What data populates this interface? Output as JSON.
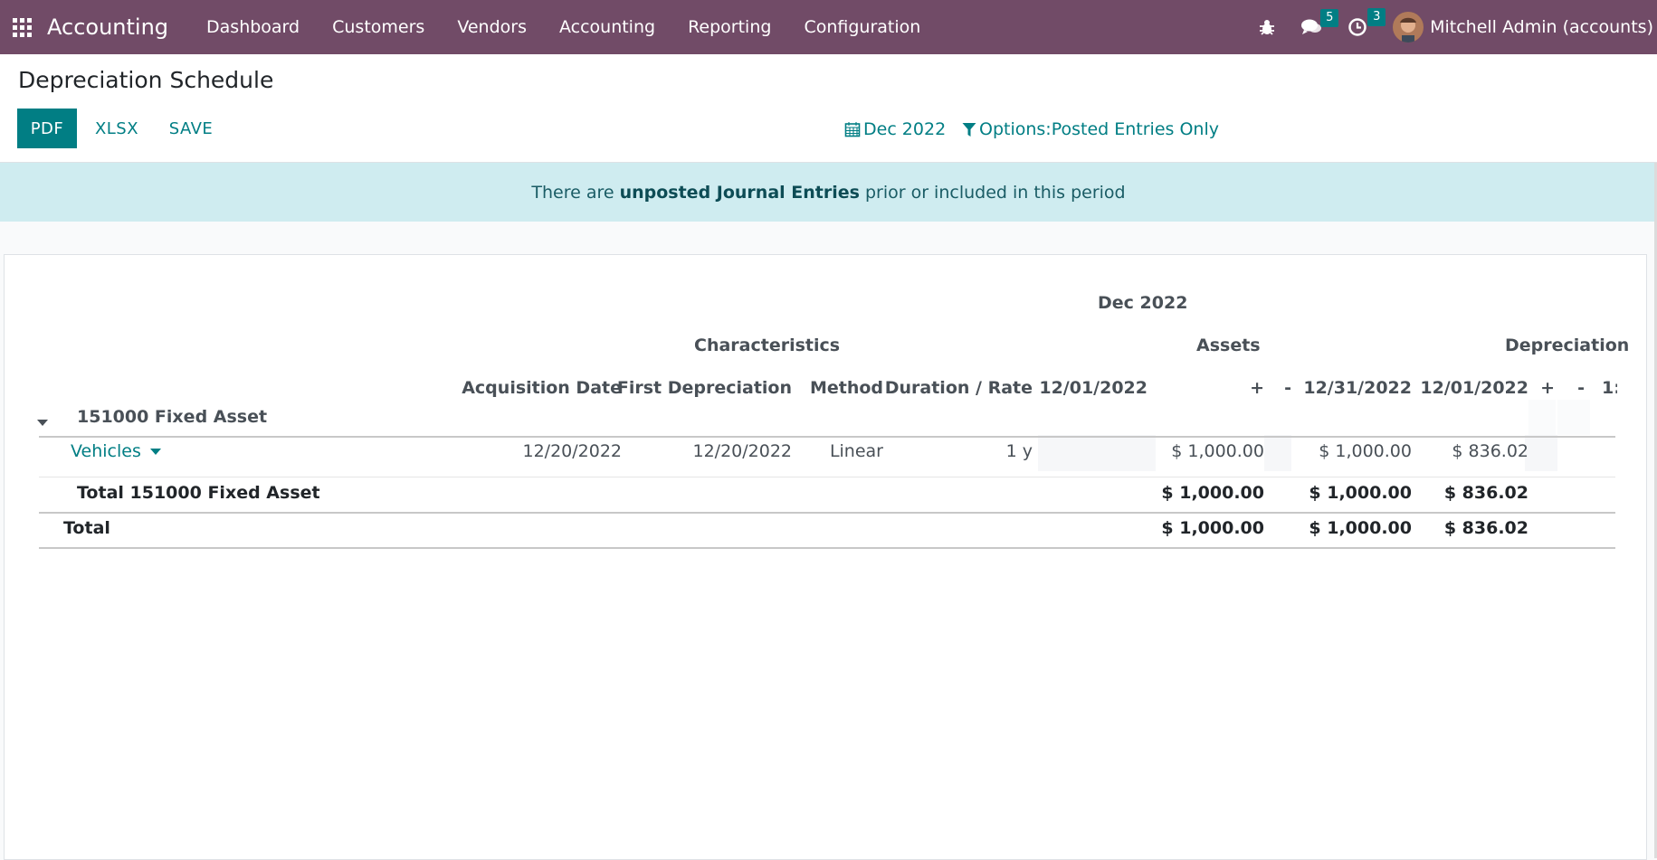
{
  "navbar": {
    "brand": "Accounting",
    "menu": [
      "Dashboard",
      "Customers",
      "Vendors",
      "Accounting",
      "Reporting",
      "Configuration"
    ],
    "messages_count": "5",
    "activities_count": "3",
    "user_name": "Mitchell Admin (accounts)",
    "icons": [
      "apps-grid-icon",
      "bug-icon",
      "chat-icon",
      "clock-icon"
    ]
  },
  "control": {
    "title": "Depreciation Schedule",
    "buttons": {
      "pdf": "PDF",
      "xlsx": "XLSX",
      "save": "SAVE"
    },
    "date_filter": "Dec 2022",
    "options_filter": "Options:Posted Entries Only"
  },
  "alert": {
    "prefix": "There are",
    "link": "unposted Journal Entries",
    "suffix": "prior or included in this period"
  },
  "report": {
    "period": "Dec 2022",
    "groups": {
      "characteristics": "Characteristics",
      "assets": "Assets",
      "depreciation": "Depreciation"
    },
    "columns": [
      "Acquisition Date",
      "First Depreciation",
      "Method",
      "Duration / Rate",
      "12/01/2022",
      "+",
      "-",
      "12/31/2022",
      "12/01/2022",
      "+",
      "-",
      "1:"
    ],
    "account": "151000 Fixed Asset",
    "rows": [
      {
        "name": "Vehicles",
        "acquisition_date": "12/20/2022",
        "first_depreciation": "12/20/2022",
        "method": "Linear",
        "duration": "1 y",
        "assets_open": "",
        "assets_plus": "$ 1,000.00",
        "assets_minus": "",
        "assets_close": "$ 1,000.00",
        "depr_open": "$ 836.02"
      }
    ],
    "subtotal": {
      "label": "Total 151000 Fixed Asset",
      "assets_plus": "$ 1,000.00",
      "assets_close": "$ 1,000.00",
      "depr_open": "$ 836.02"
    },
    "total": {
      "label": "Total",
      "assets_plus": "$ 1,000.00",
      "assets_close": "$ 1,000.00",
      "depr_open": "$ 836.02"
    }
  }
}
